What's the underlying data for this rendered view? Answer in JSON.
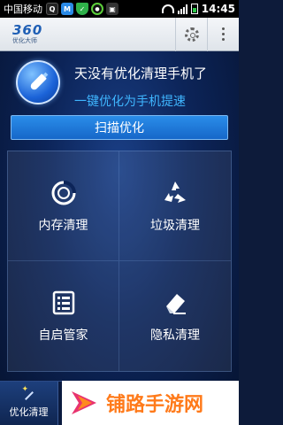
{
  "status_bar": {
    "carrier": "中国移动",
    "time": "14:45"
  },
  "app_header": {
    "logo_text": "360",
    "logo_subtext": "优化大师"
  },
  "hero": {
    "title": "天没有优化清理手机了",
    "subtitle": "一键优化为手机提速"
  },
  "scan_button": {
    "label": "扫描优化"
  },
  "tiles": [
    {
      "label": "内存清理",
      "icon": "memory-clean-icon"
    },
    {
      "label": "垃圾清理",
      "icon": "recycle-icon"
    },
    {
      "label": "自启管家",
      "icon": "startup-manager-icon"
    },
    {
      "label": "隐私清理",
      "icon": "eraser-icon"
    }
  ],
  "bottom_tab": {
    "label": "优化清理",
    "icon": "magic-wand-icon"
  },
  "watermark": {
    "text": "铺路手游网"
  }
}
